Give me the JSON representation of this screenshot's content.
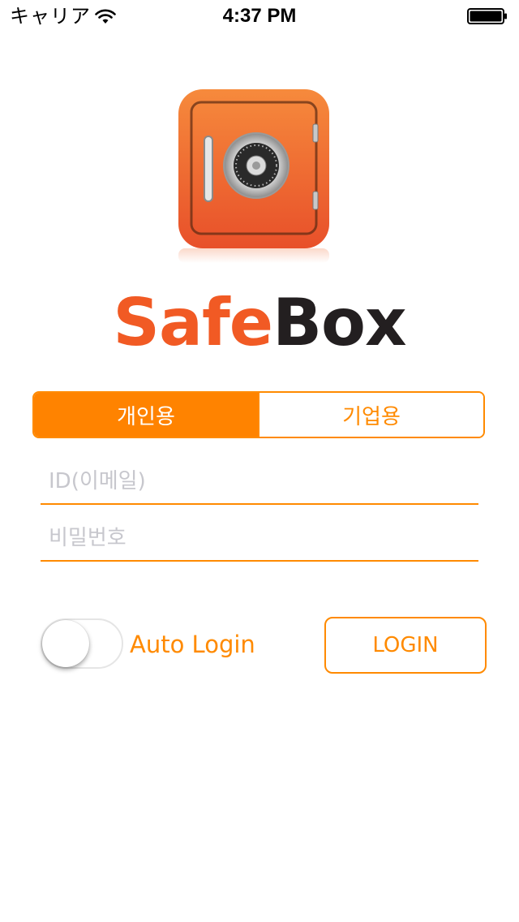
{
  "status_bar": {
    "carrier": "キャリア",
    "time": "4:37 PM",
    "wifi_icon": "wifi-icon",
    "battery_icon": "battery-full-icon"
  },
  "logo": {
    "icon": "safe-vault-icon",
    "wordmark_part1": "Safe",
    "wordmark_part2": "Box",
    "wordmark_colors": {
      "safe": "#f15a24",
      "box": "#231f20"
    }
  },
  "account_type": {
    "options": [
      "개인용",
      "기업용"
    ],
    "selected": "개인용"
  },
  "form": {
    "id_placeholder": "ID(이메일)",
    "id_value": "",
    "password_placeholder": "비밀번호",
    "password_value": ""
  },
  "auto_login": {
    "label": "Auto Login",
    "enabled": false
  },
  "login_button": {
    "label": "LOGIN"
  },
  "colors": {
    "accent": "#ff8a00",
    "segment_active": "#ff8300",
    "safe_body": "#f0642a",
    "placeholder": "#c7c7cd"
  }
}
